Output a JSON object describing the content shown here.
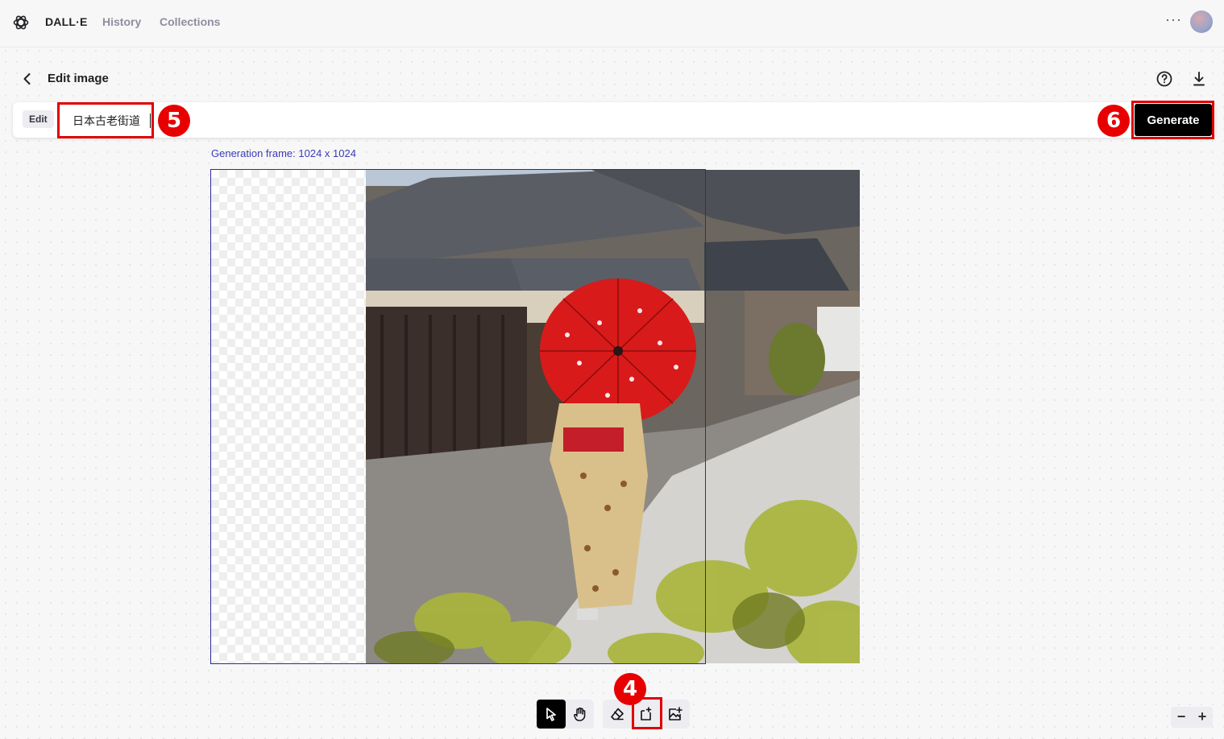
{
  "app": {
    "brand": "DALL·E",
    "nav": [
      "History",
      "Collections"
    ],
    "more": "···"
  },
  "editor": {
    "title": "Edit image",
    "mode_chip": "Edit",
    "prompt_value": "日本古老街道",
    "generate_label": "Generate",
    "frame_label": "Generation frame: 1024 x 1024"
  },
  "annotations": {
    "step_4": "4",
    "step_5": "5",
    "step_6": "6",
    "highlight_color": "#e00000"
  },
  "toolbar": {
    "tools": [
      "select-tool",
      "pan-tool",
      "eraser-tool",
      "add-frame-tool",
      "upload-image-tool"
    ],
    "active_tool": "select-tool"
  },
  "zoom": {
    "minus": "−",
    "plus": "+"
  },
  "image": {
    "subject": "photo",
    "colors": {
      "umbrella": "#d91a1a",
      "kimono": "#d9c08a",
      "roof": "#4b4e55",
      "path": "#cfcfcf",
      "foliage": "#a8b53a"
    }
  }
}
